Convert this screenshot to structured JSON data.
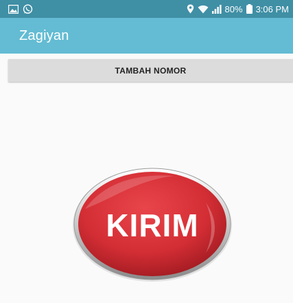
{
  "status_bar": {
    "left_icons": [
      "image-icon",
      "whatsapp-icon"
    ],
    "right_icons": [
      "location-icon",
      "wifi-icon",
      "signal-icon",
      "battery-icon"
    ],
    "battery": "80%",
    "time": "3:06 PM"
  },
  "app_bar": {
    "title": "Zagiyan"
  },
  "main": {
    "add_number_label": "TAMBAH NOMOR",
    "send_label": "KIRIM"
  },
  "colors": {
    "status_bar": "#3f8fa5",
    "app_bar": "#63bcd3",
    "button_gray": "#dcdcdc",
    "send_red": "#d42e35"
  }
}
